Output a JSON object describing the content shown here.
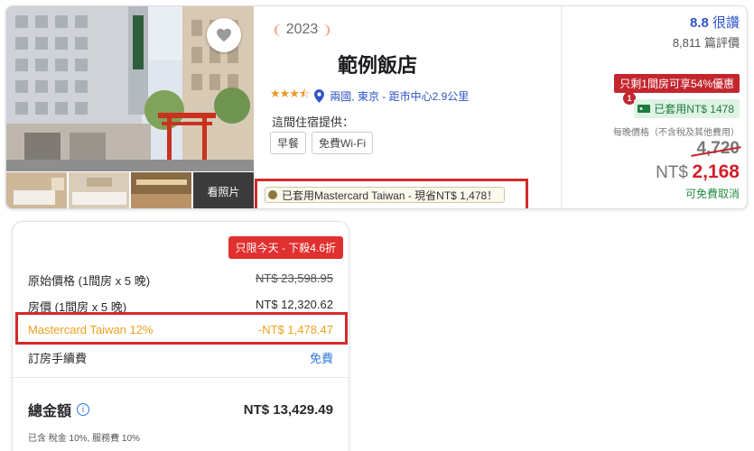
{
  "hotel": {
    "award_year": "2023",
    "name": "範例飯店",
    "location": "兩國, 東京 - 距市中心2.9公里",
    "offers_label": "這間住宿提供：",
    "amenities": [
      "早餐",
      "免費Wi-Fi"
    ],
    "see_photos": "看照片",
    "mastercard_promo": "已套用Mastercard Taiwan - 現省NT$ 1,478！",
    "stars": 3.5
  },
  "pricing": {
    "score": "8.8",
    "score_word": "很讚",
    "reviews": "8,811 篇評價",
    "urgency": "只剩1間房可享54%優惠",
    "badge_count": "1",
    "applied_discount": "已套用NT$ 1478",
    "per_night_note": "每晚價格（不含稅及其他費用）",
    "original_price": "4,720",
    "currency": "NT$",
    "final_price": "2,168",
    "free_cancel": "可免費取消"
  },
  "breakdown": {
    "deal_badge": "只限今天 - 下殺4.6折",
    "rows": [
      {
        "label": "原始價格 (1間房 x 5 晚)",
        "value": "NT$ 23,598.95"
      },
      {
        "label": "房價 (1間房 x 5 晚)",
        "value": "NT$ 12,320.62"
      },
      {
        "label": "Mastercard Taiwan 12%",
        "value": "-NT$ 1,478.47"
      },
      {
        "label": "訂房手續費",
        "value": "免費"
      }
    ],
    "total_label": "總金額",
    "total_value": "NT$ 13,429.49",
    "tax_note": "已含 稅金 10%, 服務費 10%"
  },
  "colors": {
    "accent_blue": "#2f55c8",
    "sale_red": "#d21f2b",
    "discount_orange": "#f0a020",
    "highlight_box": "#d42a2a"
  }
}
